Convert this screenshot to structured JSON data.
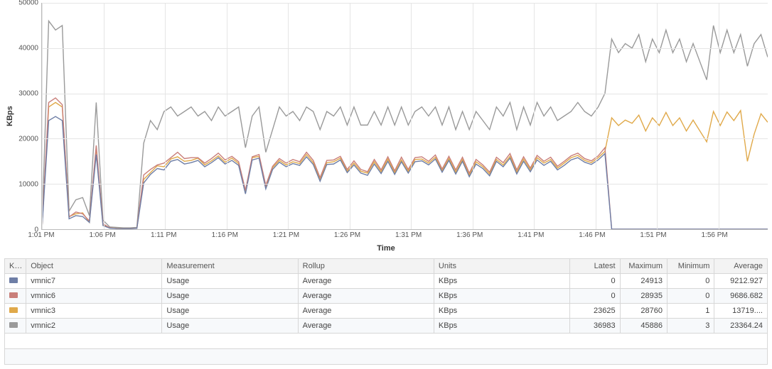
{
  "chart_data": {
    "type": "line",
    "title": "",
    "xlabel": "Time",
    "ylabel": "KBps",
    "ylim": [
      0,
      50000
    ],
    "yticks": [
      0,
      10000,
      20000,
      30000,
      40000,
      50000
    ],
    "categories": [
      "1:01 PM",
      "1:06 PM",
      "1:11 PM",
      "1:16 PM",
      "1:21 PM",
      "1:26 PM",
      "1:31 PM",
      "1:36 PM",
      "1:41 PM",
      "1:46 PM",
      "1:51 PM",
      "1:56 PM"
    ],
    "series": [
      {
        "name": "vmnic2",
        "color": "#9a9a9a",
        "values": [
          200,
          46000,
          44000,
          45000,
          4000,
          6500,
          7000,
          3000,
          28000,
          2000,
          500,
          400,
          300,
          300,
          400,
          19000,
          24000,
          22000,
          26000,
          27000,
          25000,
          26000,
          27000,
          25000,
          26000,
          24000,
          27000,
          25000,
          26000,
          27000,
          18000,
          25000,
          27000,
          17000,
          22000,
          27000,
          25000,
          26000,
          24000,
          27000,
          26000,
          22000,
          26000,
          25000,
          27000,
          23000,
          27000,
          23000,
          23000,
          26000,
          23000,
          27000,
          23000,
          27000,
          23000,
          26000,
          27000,
          25000,
          27000,
          23000,
          27000,
          22000,
          26000,
          22000,
          26000,
          24000,
          22000,
          27000,
          25000,
          28000,
          22000,
          27000,
          23000,
          28000,
          25000,
          27000,
          24000,
          25000,
          26000,
          28000,
          26000,
          25000,
          27000,
          30000,
          42000,
          39000,
          41000,
          40000,
          43000,
          37000,
          42000,
          39000,
          44000,
          39000,
          42000,
          37000,
          41000,
          37000,
          33000,
          45000,
          39000,
          44000,
          39000,
          43000,
          36000,
          41000,
          43000,
          38000
        ]
      },
      {
        "name": "vmnic3",
        "color": "#e0a94a",
        "values": [
          100,
          27000,
          28000,
          27000,
          2800,
          3400,
          3600,
          1500,
          18000,
          900,
          300,
          200,
          150,
          150,
          200,
          11000,
          12500,
          14000,
          13800,
          15500,
          16000,
          15000,
          15200,
          15700,
          14200,
          15100,
          16200,
          14800,
          15700,
          14500,
          8200,
          15800,
          16100,
          9200,
          13600,
          15200,
          14200,
          14900,
          14500,
          16500,
          14700,
          11000,
          14700,
          14900,
          15700,
          12800,
          14600,
          12800,
          12400,
          14900,
          12700,
          15500,
          12500,
          15300,
          12800,
          15400,
          15500,
          14600,
          15900,
          12900,
          15600,
          12600,
          15400,
          12000,
          14900,
          13800,
          12200,
          15400,
          14200,
          16100,
          12600,
          15500,
          13100,
          15800,
          14600,
          15400,
          13500,
          14600,
          15800,
          16300,
          15200,
          14700,
          15800,
          17200,
          24600,
          22900,
          24100,
          23400,
          25200,
          21700,
          24600,
          22900,
          25800,
          22900,
          24600,
          21700,
          24100,
          21700,
          19300,
          26000,
          22900,
          25900,
          24000,
          26200,
          15000,
          21000,
          25500,
          23625
        ]
      },
      {
        "name": "vmnic6",
        "color": "#c97f7a",
        "values": [
          100,
          28000,
          29000,
          27500,
          2700,
          3800,
          3400,
          1800,
          18500,
          1200,
          300,
          150,
          150,
          150,
          200,
          12000,
          13200,
          14200,
          14600,
          15800,
          17000,
          15600,
          15800,
          15800,
          14600,
          15600,
          16800,
          15300,
          16100,
          14900,
          8600,
          16000,
          16500,
          9700,
          13900,
          15600,
          14600,
          15400,
          14900,
          17000,
          15200,
          11400,
          15200,
          15300,
          16100,
          13200,
          15100,
          13200,
          12700,
          15400,
          13100,
          16000,
          12900,
          15900,
          13200,
          15800,
          16000,
          15000,
          16400,
          13300,
          16100,
          13100,
          15900,
          12400,
          15400,
          14200,
          12600,
          15900,
          14700,
          16700,
          13100,
          16000,
          13500,
          16300,
          15000,
          15900,
          13900,
          15000,
          16200,
          16800,
          15600,
          15100,
          16200,
          18000,
          0,
          0,
          0,
          0,
          0,
          0,
          0,
          0,
          0,
          0,
          0,
          0,
          0,
          0,
          0,
          0,
          0,
          0,
          0,
          0,
          0,
          0,
          0,
          0
        ]
      },
      {
        "name": "vmnic7",
        "color": "#6e7ea6",
        "values": [
          80,
          24000,
          24900,
          24000,
          2300,
          3000,
          2800,
          1500,
          16500,
          800,
          220,
          140,
          120,
          120,
          180,
          10200,
          12100,
          13400,
          13100,
          15000,
          15400,
          14400,
          14700,
          15200,
          13800,
          14700,
          15800,
          14400,
          15200,
          14100,
          7800,
          15300,
          15700,
          8900,
          13200,
          14800,
          13800,
          14500,
          14100,
          16000,
          14300,
          10600,
          14300,
          14400,
          15300,
          12500,
          14200,
          12400,
          11900,
          14400,
          12300,
          15000,
          12100,
          14900,
          12400,
          14900,
          15100,
          14200,
          15500,
          12600,
          15200,
          12200,
          15000,
          11600,
          14400,
          13400,
          11800,
          15000,
          13800,
          15700,
          12200,
          15000,
          12700,
          15300,
          14100,
          15000,
          13100,
          14100,
          15300,
          15800,
          14800,
          14300,
          15300,
          16700,
          0,
          0,
          0,
          0,
          0,
          0,
          0,
          0,
          0,
          0,
          0,
          0,
          0,
          0,
          0,
          0,
          0,
          0,
          0,
          0,
          0,
          0,
          0,
          0
        ]
      }
    ]
  },
  "table": {
    "headers": {
      "key": "Key",
      "object": "Object",
      "measurement": "Measurement",
      "rollup": "Rollup",
      "units": "Units",
      "latest": "Latest",
      "maximum": "Maximum",
      "minimum": "Minimum",
      "average": "Average"
    },
    "rows": [
      {
        "color": "#6e7ea6",
        "object": "vmnic7",
        "measurement": "Usage",
        "rollup": "Average",
        "units": "KBps",
        "latest": "0",
        "maximum": "24913",
        "minimum": "0",
        "average": "9212.927"
      },
      {
        "color": "#c97f7a",
        "object": "vmnic6",
        "measurement": "Usage",
        "rollup": "Average",
        "units": "KBps",
        "latest": "0",
        "maximum": "28935",
        "minimum": "0",
        "average": "9686.682"
      },
      {
        "color": "#e0a94a",
        "object": "vmnic3",
        "measurement": "Usage",
        "rollup": "Average",
        "units": "KBps",
        "latest": "23625",
        "maximum": "28760",
        "minimum": "1",
        "average": "13719...."
      },
      {
        "color": "#9a9a9a",
        "object": "vmnic2",
        "measurement": "Usage",
        "rollup": "Average",
        "units": "KBps",
        "latest": "36983",
        "maximum": "45886",
        "minimum": "3",
        "average": "23364.24"
      }
    ]
  }
}
